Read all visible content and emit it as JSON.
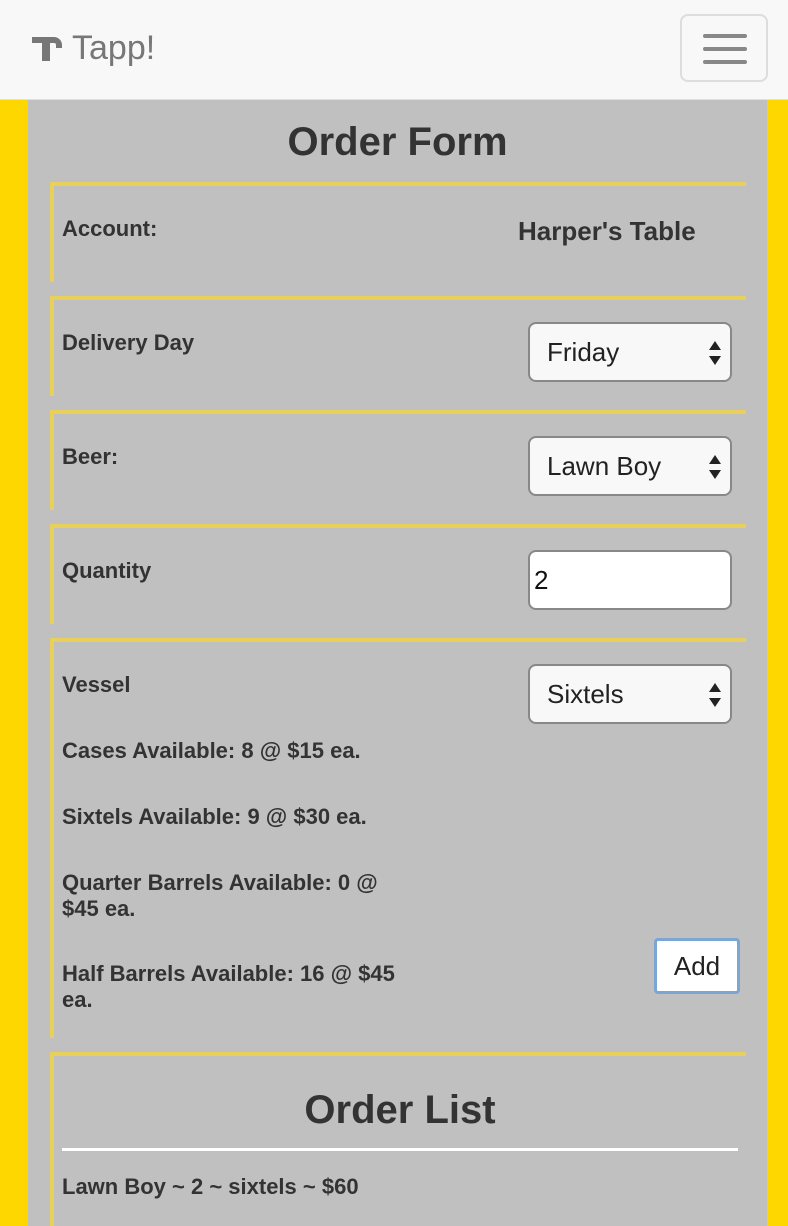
{
  "navbar": {
    "brand": "Tapp!",
    "brand_icon": "beer-tap-icon",
    "menu_icon": "hamburger-menu-icon"
  },
  "form": {
    "title": "Order Form",
    "account": {
      "label": "Account:",
      "value": "Harper's Table"
    },
    "delivery_day": {
      "label": "Delivery Day",
      "selected": "Friday"
    },
    "beer": {
      "label": "Beer:",
      "selected": "Lawn Boy"
    },
    "quantity": {
      "label": "Quantity",
      "value": "2"
    },
    "vessel": {
      "label": "Vessel",
      "selected": "Sixtels",
      "availability": [
        "Cases Available: 8 @ $15 ea.",
        "Sixtels Available: 9 @ $30 ea.",
        "Quarter Barrels Available: 0 @ $45 ea.",
        "Half Barrels Available: 16 @ $45 ea."
      ],
      "add_label": "Add"
    }
  },
  "order_list": {
    "title": "Order List",
    "items": [
      "Lawn Boy ~ 2 ~ sixtels ~ $60"
    ]
  },
  "colors": {
    "page_bg": "#ffd700",
    "container_bg": "#c0c0c0",
    "panel_border": "#e8d05a",
    "navbar_bg": "#f8f8f8"
  }
}
